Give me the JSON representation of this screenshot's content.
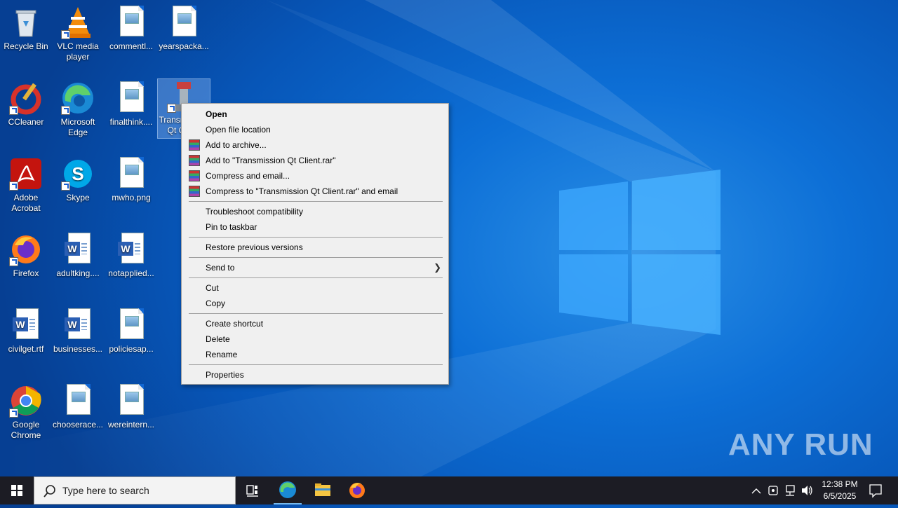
{
  "desktop": {
    "icons": [
      {
        "label": "Recycle Bin"
      },
      {
        "label": "VLC media player"
      },
      {
        "label": "commentl..."
      },
      {
        "label": "yearspacka..."
      },
      {
        "label": "CCleaner"
      },
      {
        "label": "Microsoft Edge"
      },
      {
        "label": "finalthink...."
      },
      {
        "label": "Transmission Qt Client"
      },
      {
        "label": "Adobe Acrobat"
      },
      {
        "label": "Skype"
      },
      {
        "label": "mwho.png"
      },
      {
        "label": "Firefox"
      },
      {
        "label": "adultking...."
      },
      {
        "label": "notapplied..."
      },
      {
        "label": "civilget.rtf"
      },
      {
        "label": "businesses..."
      },
      {
        "label": "policiesap..."
      },
      {
        "label": "Google Chrome"
      },
      {
        "label": "chooserace..."
      },
      {
        "label": "wereintern..."
      }
    ]
  },
  "context_menu": {
    "items": [
      {
        "label": "Open"
      },
      {
        "label": "Open file location"
      },
      {
        "label": "Add to archive..."
      },
      {
        "label": "Add to \"Transmission Qt Client.rar\""
      },
      {
        "label": "Compress and email..."
      },
      {
        "label": "Compress to \"Transmission Qt Client.rar\" and email"
      },
      {
        "label": "Troubleshoot compatibility"
      },
      {
        "label": "Pin to taskbar"
      },
      {
        "label": "Restore previous versions"
      },
      {
        "label": "Send to"
      },
      {
        "label": "Cut"
      },
      {
        "label": "Copy"
      },
      {
        "label": "Create shortcut"
      },
      {
        "label": "Delete"
      },
      {
        "label": "Rename"
      },
      {
        "label": "Properties"
      }
    ]
  },
  "taskbar": {
    "search_placeholder": "Type here to search",
    "time": "12:38 PM",
    "date": "6/5/2025"
  },
  "watermark": "ANY RUN"
}
